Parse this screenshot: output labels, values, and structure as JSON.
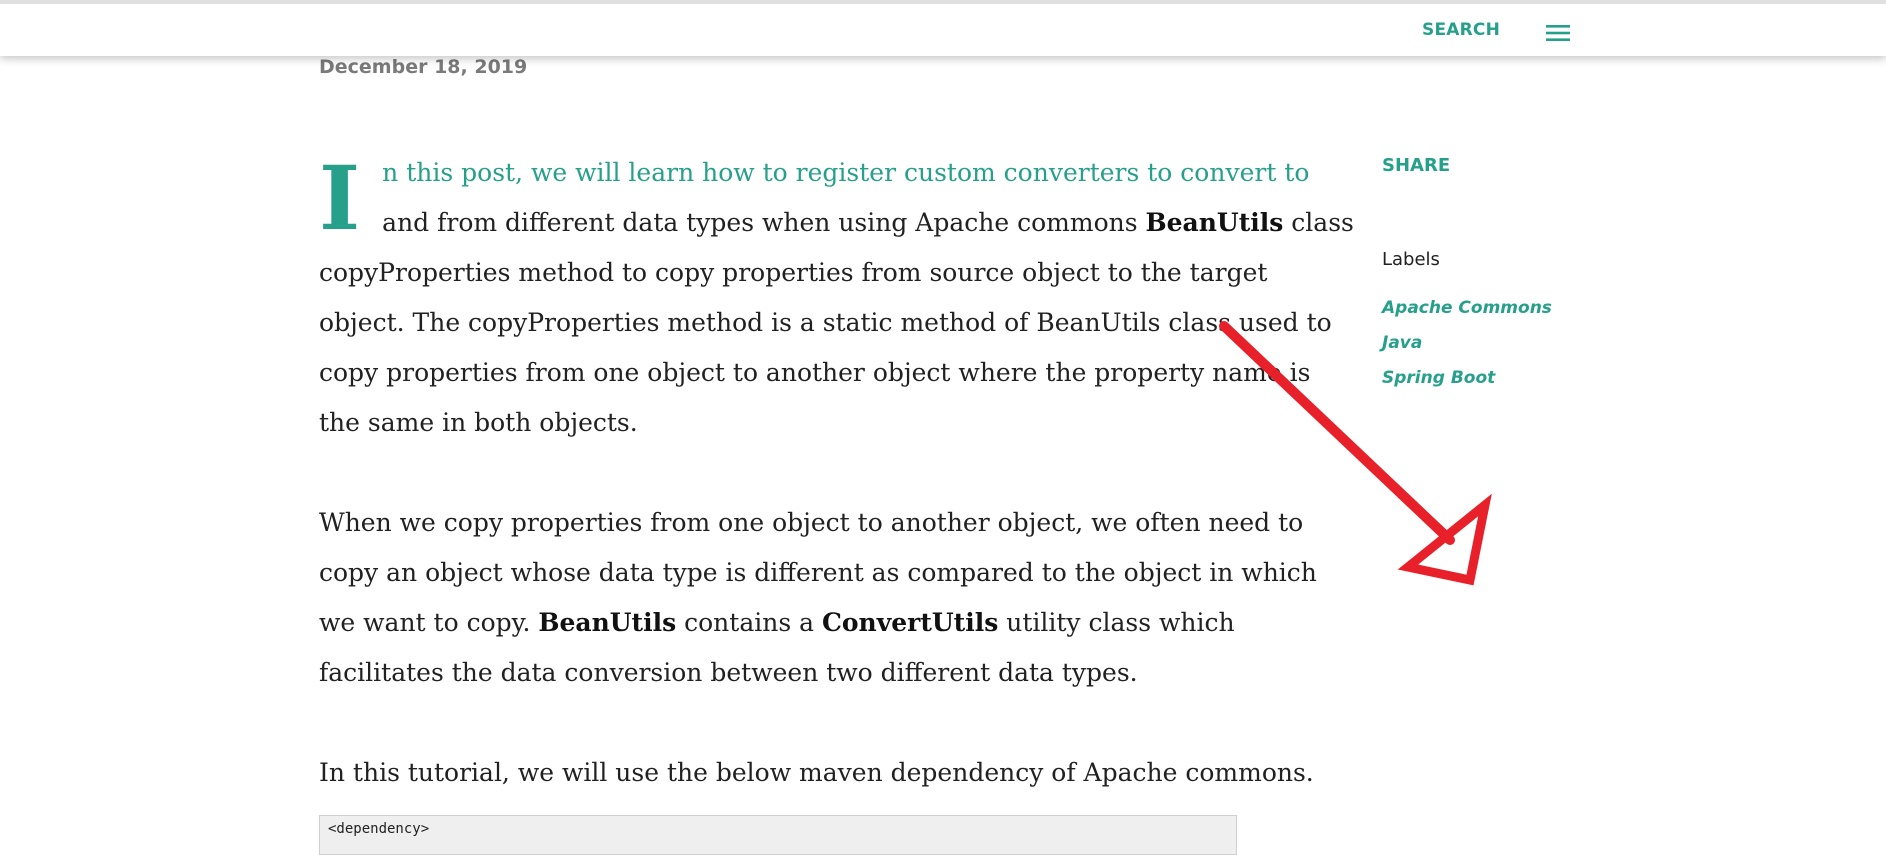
{
  "header": {
    "search_label": "SEARCH",
    "menu_icon": "hamburger-menu-icon"
  },
  "post": {
    "date": "December 18, 2019",
    "intro": {
      "drop_cap": "I",
      "first_line": "n this post, we will learn how to register custom converters to convert to",
      "lines": [
        [
          "and from different data types when using Apache commons ",
          {
            "b": "BeanUtils"
          },
          " class"
        ],
        [
          "copyProperties method to copy properties from source object to the target"
        ],
        [
          "object. The copyProperties method is a static method of BeanUtils class used to"
        ],
        [
          "copy properties from one object to another object where the property name is"
        ],
        [
          "the same in both objects."
        ]
      ]
    },
    "para2_lines": [
      [
        "When we copy properties from one object to another object, we often need to"
      ],
      [
        "copy an object whose data type is different as compared to the object in which"
      ],
      [
        "we want to copy. ",
        {
          "b": "BeanUtils"
        },
        " contains a ",
        {
          "b": "ConvertUtils"
        },
        " utility class which"
      ],
      [
        "facilitates the data conversion between two different data types."
      ]
    ],
    "para3": "In this tutorial, we will use the below maven dependency of Apache commons.",
    "code": "<dependency>"
  },
  "sidebar": {
    "share_label": "SHARE",
    "labels_heading": "Labels",
    "labels": [
      "Apache Commons",
      "Java",
      "Spring Boot"
    ]
  },
  "colors": {
    "accent": "#26a08a",
    "annotation_arrow": "#e8202a",
    "text": "#212121"
  }
}
